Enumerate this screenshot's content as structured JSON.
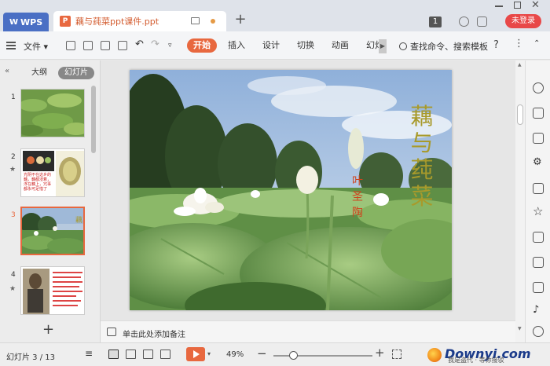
{
  "titlebar": {
    "app_tab": "WPS",
    "doc_tab": "藕与莼菜ppt课件.ppt",
    "notification_count": "1",
    "login_button": "未登录"
  },
  "ribbon": {
    "file_menu": "文件",
    "tabs": [
      "开始",
      "插入",
      "设计",
      "切换",
      "动画",
      "幻灯"
    ],
    "active_tab": "开始",
    "search_command": "查找命令、搜索模板",
    "help": "?"
  },
  "left_panel": {
    "tab_outline": "大纲",
    "tab_slides": "幻灯片",
    "active_tab": "幻灯片",
    "slides": [
      {
        "number": "1"
      },
      {
        "number": "2",
        "text": "光阴不在这乡的藕，藕都浸着，浮在藕上，冗事都永可足惜了"
      },
      {
        "number": "3",
        "selected": true
      },
      {
        "number": "4"
      }
    ],
    "add_slide": "+"
  },
  "slide": {
    "title": "藕与莼菜",
    "author": "叶圣陶"
  },
  "notes": {
    "placeholder": "单击此处添加备注"
  },
  "statusbar": {
    "slide_info": "幻灯片 3 / 13",
    "zoom": "49%",
    "zoom_level": 0.2,
    "zoom_minus": "−",
    "zoom_plus": "+"
  },
  "watermark": {
    "brand": "Downyi.com",
    "sub": "我是盗代 · 等你接驳"
  },
  "colors": {
    "accent": "#e8683f",
    "wps_blue": "#4a6fc4",
    "login_red": "#e84848",
    "title_olive": "#a89a2b",
    "author_red": "#d0431d"
  }
}
